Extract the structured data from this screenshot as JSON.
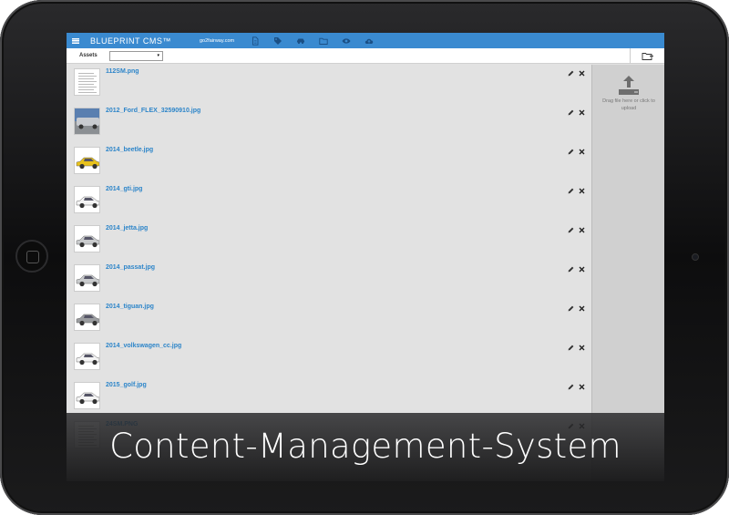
{
  "app": {
    "brand": "BLUEPRINT CMS™",
    "site": "go2fairway.com",
    "toolbar_icons": [
      "document-icon",
      "tag-icon",
      "car-icon",
      "folder-icon",
      "eye-icon",
      "cloud-upload-icon"
    ]
  },
  "toolbar": {
    "label": "Assets",
    "select_value": ""
  },
  "assets": [
    {
      "filename": "112SM.png",
      "thumb": "document"
    },
    {
      "filename": "2012_Ford_FLEX_32590910.jpg",
      "thumb": "photo-lot"
    },
    {
      "filename": "2014_beetle.jpg",
      "thumb": "car-yellow"
    },
    {
      "filename": "2014_gti.jpg",
      "thumb": "car-white"
    },
    {
      "filename": "2014_jetta.jpg",
      "thumb": "car-silver"
    },
    {
      "filename": "2014_passat.jpg",
      "thumb": "car-silver"
    },
    {
      "filename": "2014_tiguan.jpg",
      "thumb": "car-grey"
    },
    {
      "filename": "2014_volkswagen_cc.jpg",
      "thumb": "car-white"
    },
    {
      "filename": "2015_golf.jpg",
      "thumb": "car-white"
    },
    {
      "filename": "24SM.PNG",
      "thumb": "document"
    }
  ],
  "upload": {
    "text": "Drag file here or click to upload"
  },
  "caption": "Content-Management-System",
  "colors": {
    "topbar": "#3a8ad0",
    "link": "#2d85c9",
    "list_bg": "#e2e2e2",
    "upload_bg": "#d0d0d0"
  }
}
